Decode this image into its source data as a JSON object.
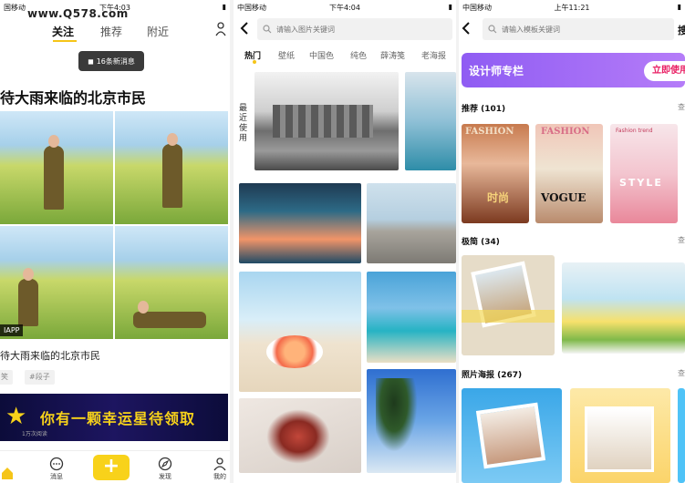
{
  "screen1": {
    "status": {
      "carrier": "国移动",
      "time": "下午4:03"
    },
    "watermark": "www.Q578.com",
    "tabs": [
      {
        "label": "关注"
      },
      {
        "label": "推荐"
      },
      {
        "label": "附近"
      }
    ],
    "new_messages": "16条新消息",
    "post_title": "待大雨来临的北京市民",
    "app_label": "IAPP",
    "caption": "待大雨来临的北京市民",
    "tags": [
      "笑",
      "#段子"
    ],
    "banner": {
      "text": "你有一颗幸运星待领取",
      "sub": "1万次阅读"
    },
    "tabbar": {
      "home": "",
      "messages": "消息",
      "discover": "发现",
      "me": "我的"
    },
    "colors": {
      "accent": "#f5c518"
    }
  },
  "screen2": {
    "status": {
      "carrier": "中国移动",
      "time": "下午4:04"
    },
    "search_placeholder": "请输入图片关键词",
    "categories": [
      {
        "label": "热门"
      },
      {
        "label": "壁纸"
      },
      {
        "label": "中国色"
      },
      {
        "label": "纯色"
      },
      {
        "label": "薛涛笺"
      },
      {
        "label": "老海报"
      }
    ],
    "recent_label": "最近使用"
  },
  "screen3": {
    "status": {
      "carrier": "中国移动",
      "time": "上午11:21"
    },
    "search_placeholder": "请输入模板关键词",
    "right_action": "搜",
    "promo": {
      "title": "设计师专栏",
      "button": "立即使用"
    },
    "sections": [
      {
        "title": "推荐 (101)",
        "more": "查"
      },
      {
        "title": "极简 (34)",
        "more": "查"
      },
      {
        "title": "照片海报 (267)",
        "more": "查"
      }
    ],
    "recommend_cards": [
      {
        "title": "FASHION",
        "subtitle": "时尚"
      },
      {
        "title": "FASHION",
        "subtitle": "VOGUE"
      },
      {
        "title": "Fashion trend",
        "subtitle": "STYLE"
      }
    ]
  }
}
